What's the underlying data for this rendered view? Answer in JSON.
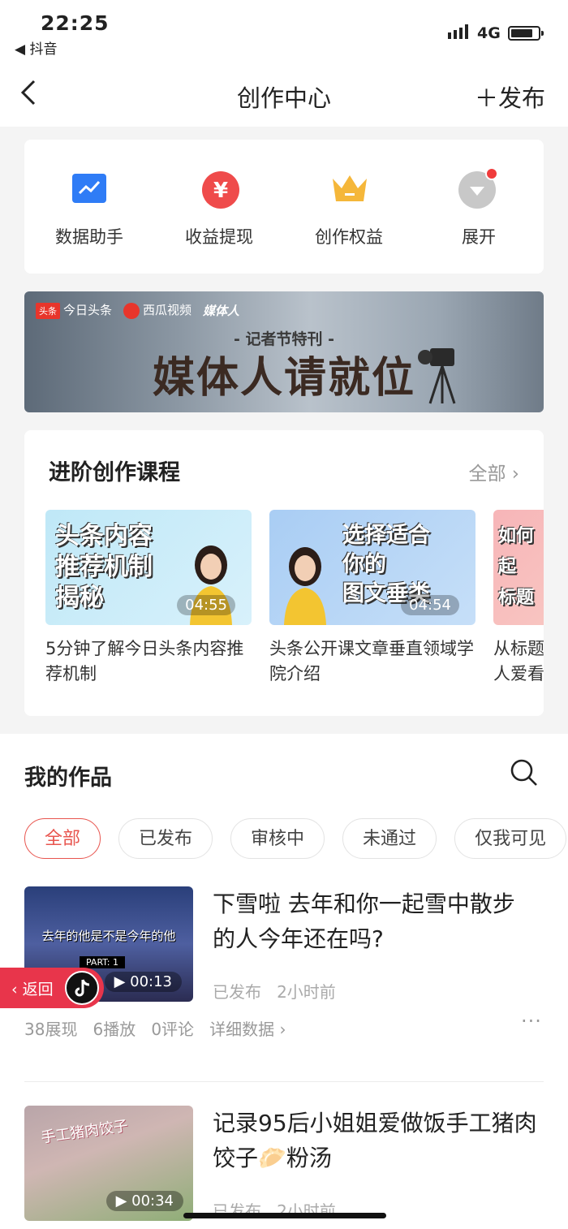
{
  "status_bar": {
    "time": "22:25",
    "back_app": "◀ 抖音",
    "network": "4G"
  },
  "nav": {
    "title": "创作中心",
    "publish": "＋发布"
  },
  "tools": [
    {
      "label": "数据助手",
      "icon": "chart-icon",
      "color": "#2f7cf6"
    },
    {
      "label": "收益提现",
      "icon": "yen-icon",
      "color": "#ef4b4b"
    },
    {
      "label": "创作权益",
      "icon": "crown-icon",
      "color": "#f5b73a"
    },
    {
      "label": "展开",
      "icon": "expand-icon",
      "color": "#c8c8c8"
    }
  ],
  "banner": {
    "logos": [
      "今日头条",
      "西瓜视频",
      "媒体人"
    ],
    "subtitle": "- 记者节特刊 -",
    "title": "媒体人请就位"
  },
  "courses": {
    "title": "进阶创作课程",
    "all_label": "全部 ›",
    "items": [
      {
        "thumb_text": "头条内容\n推荐机制\n揭秘",
        "duration": "04:55",
        "caption": "5分钟了解今日头条内容推荐机制"
      },
      {
        "thumb_text": "选择适合\n你的\n图文垂类",
        "duration": "04:54",
        "caption": "头条公开课文章垂直领域学院介绍"
      },
      {
        "thumb_text": "如何\n起\n标题",
        "duration": "",
        "caption": "从标题人爱看"
      }
    ]
  },
  "works": {
    "title": "我的作品",
    "filters": [
      "全部",
      "已发布",
      "审核中",
      "未通过",
      "仅我可见"
    ],
    "items": [
      {
        "title": "下雪啦 去年和你一起雪中散步的人今年还在吗?",
        "thumb_text": "去年的他是不是今年的他",
        "thumb_tag": "PART: 1",
        "duration": "▶ 00:13",
        "status": "已发布",
        "time": "2小时前",
        "stats": "38展现   6播放   0评论   详细数据 ›",
        "more": "···"
      },
      {
        "title": "记录95后小姐姐爱做饭手工猪肉饺子🥟粉汤",
        "thumb_text": "手工猪肉饺子",
        "duration": "▶ 00:34",
        "status": "已发布",
        "time": "2小时前"
      }
    ]
  },
  "return_pill": {
    "label": "‹ 返回"
  }
}
